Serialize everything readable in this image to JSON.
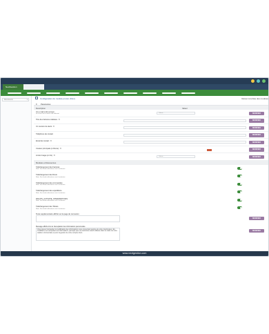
{
  "app": {
    "tab_label": "NextGestion"
  },
  "colors": {
    "titlebar": "#263c55",
    "menubar": "#3c8c3b",
    "button": "#9a7aa3",
    "toggle_on": "#3c8c3b",
    "swatch": "#cc5a3a",
    "footer": "#26384c",
    "dot_yellow": "#f2c744",
    "dot_teal": "#5bc4c4",
    "dot_green": "#6cc070"
  },
  "sidebar": {
    "search_value": "Documents"
  },
  "header": {
    "title": "Configuration du module proton (fr/en)",
    "back_link": "Retour à la liste des modules"
  },
  "subtabs": [
    "fr",
    "Paramètres"
  ],
  "columns": {
    "description": "Description",
    "value": "Valeur"
  },
  "settings": [
    {
      "label": "Un e-mail a été envoyé",
      "sub": "Si l'envoi d'un e-mail a été effectué",
      "value": "Valeur...",
      "button": "MODIFIER"
    },
    {
      "label": "Titre des factures réalisées : fr",
      "sub": "",
      "value": "",
      "button": "MODIFIER"
    },
    {
      "label": "Un numéro de devis : fr",
      "sub": "",
      "value": "",
      "button": "MODIFIER"
    },
    {
      "label": "Téléphone de contact",
      "sub": "",
      "value": "",
      "button": "MODIFIER"
    },
    {
      "label": "Email de contact : fr",
      "sub": "",
      "value": "",
      "button": "MODIFIER"
    },
    {
      "label": "Couleur principale (si thème) : fr",
      "sub": "",
      "value": "",
      "button": "MODIFIER"
    },
    {
      "label": "Limite Image (en Ko) : fr",
      "sub": "",
      "value": "Valeur...",
      "button": "MODIFIER"
    }
  ],
  "section_title": "Modules et Ressources",
  "toggles": [
    {
      "label": "Téléchargement des Factures",
      "sub": "Note: Des fonds utilisateurs sont à autoriser"
    },
    {
      "label": "Téléchargement des Devis",
      "sub": "Note: Des fonds utilisateurs sont à autoriser"
    },
    {
      "label": "Téléchargement des commandes",
      "sub": "Note: Des fonds utilisateurs sont à autoriser"
    },
    {
      "label": "Téléchargement des expéditions",
      "sub": "Note: Des fonds utilisateurs sont à autoriser"
    },
    {
      "label": "RIGHTS_ACTIVATE_INTERVENTIONS",
      "sub": "Note: Des fonds utilisateurs sont à autoriser"
    },
    {
      "label": "Téléchargement des Tickets",
      "sub": "Note: Des fonds utilisateurs sont à autoriser"
    }
  ],
  "textarea_row": {
    "label": "Texte supplémentaire affiché sur la page de connexion",
    "button": "MODIFIER"
  },
  "notice_row": {
    "label": "Message affiché lors de l'acceptation des informations personnelles",
    "text": "Vous pouvez demander la modification des informations vous concernant auprès de votre interlocuteur. En modifiant et en acceptant ces informations, j'accepte que ces dernières soient utilisées dans le cadre de notre relation commerciale et pour la gestion de votre compte client.",
    "button": "MODIFIER"
  },
  "footer": {
    "text": "www.nextgestion.com"
  }
}
